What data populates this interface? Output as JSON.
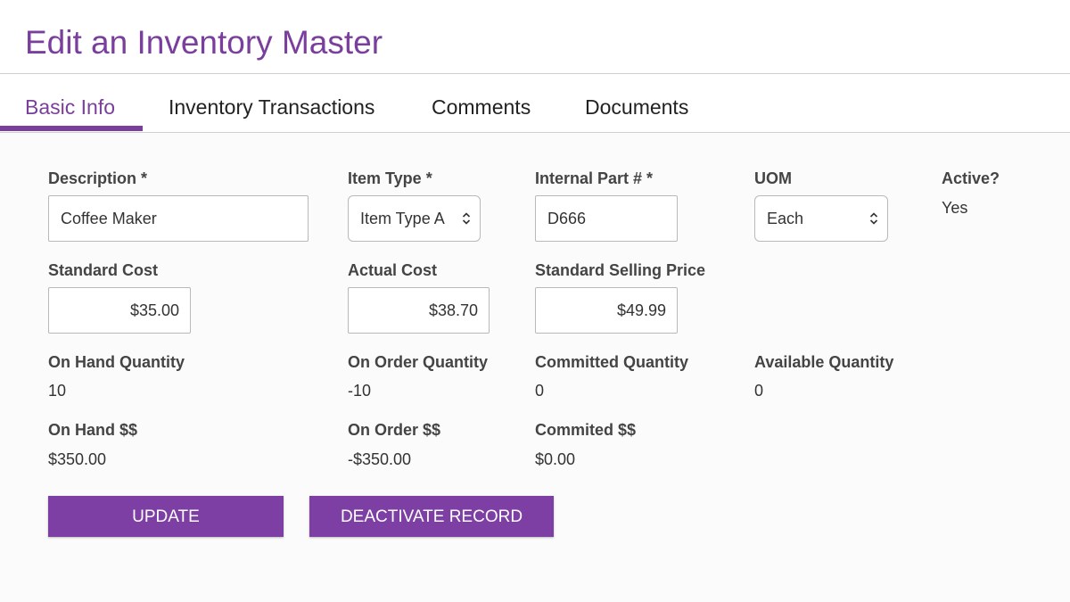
{
  "page": {
    "title": "Edit an Inventory Master"
  },
  "tabs": [
    {
      "label": "Basic Info",
      "active": true
    },
    {
      "label": "Inventory Transactions",
      "active": false
    },
    {
      "label": "Comments",
      "active": false
    },
    {
      "label": "Documents",
      "active": false
    }
  ],
  "form": {
    "description": {
      "label": "Description *",
      "value": "Coffee Maker"
    },
    "item_type": {
      "label": "Item Type *",
      "value": "Item Type A"
    },
    "internal_part": {
      "label": "Internal Part # *",
      "value": "D666"
    },
    "uom": {
      "label": "UOM",
      "value": "Each"
    },
    "active": {
      "label": "Active?",
      "value": "Yes"
    },
    "standard_cost": {
      "label": "Standard Cost",
      "value": "$35.00"
    },
    "actual_cost": {
      "label": "Actual Cost",
      "value": "$38.70"
    },
    "standard_selling_price": {
      "label": "Standard Selling Price",
      "value": "$49.99"
    },
    "on_hand_quantity": {
      "label": "On Hand Quantity",
      "value": "10"
    },
    "on_order_quantity": {
      "label": "On Order Quantity",
      "value": "-10"
    },
    "committed_quantity": {
      "label": "Committed Quantity",
      "value": "0"
    },
    "available_quantity": {
      "label": "Available Quantity",
      "value": "0"
    },
    "on_hand_dollars": {
      "label": "On Hand $$",
      "value": "$350.00"
    },
    "on_order_dollars": {
      "label": "On Order $$",
      "value": "-$350.00"
    },
    "committed_dollars": {
      "label": "Commited $$",
      "value": "$0.00"
    }
  },
  "buttons": {
    "update": "UPDATE",
    "deactivate": "DEACTIVATE RECORD"
  },
  "colors": {
    "accent": "#7a3e9d",
    "button": "#7d3fa3"
  },
  "icons": {
    "select_arrow": "chevron-up-down-icon"
  }
}
